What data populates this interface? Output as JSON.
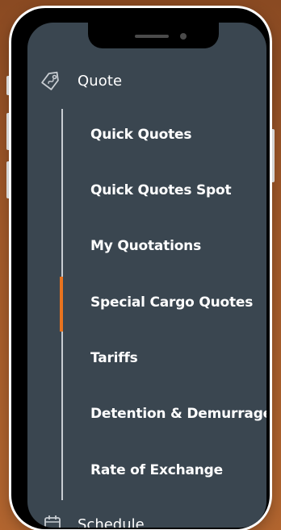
{
  "menu": {
    "section_title": "Quote",
    "section_icon": "price-tag-icon",
    "items": [
      {
        "label": "Quick Quotes",
        "active": false
      },
      {
        "label": "Quick Quotes Spot",
        "active": false
      },
      {
        "label": "My Quotations",
        "active": false
      },
      {
        "label": "Special Cargo Quotes",
        "active": true
      },
      {
        "label": "Tariffs",
        "active": false
      },
      {
        "label": "Detention & Demurrage",
        "active": false
      },
      {
        "label": "Rate of Exchange",
        "active": false
      }
    ],
    "next_section_title": "Schedule",
    "next_section_icon": "calendar-icon"
  },
  "colors": {
    "background": "#a35a2a",
    "panel": "#3a4650",
    "accent": "#e8731e",
    "text": "#ffffff"
  }
}
